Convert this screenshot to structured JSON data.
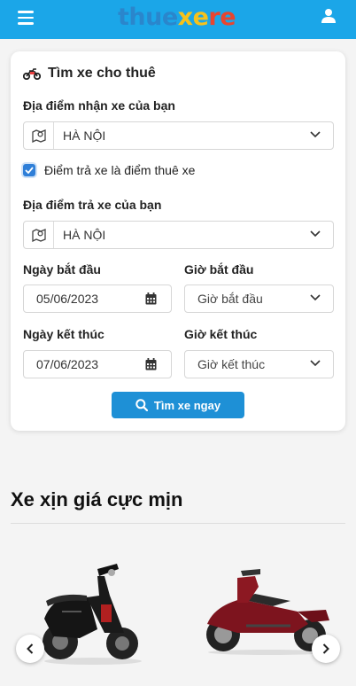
{
  "header": {
    "logo_part1": "thue",
    "logo_part2": "xe",
    "logo_part3": "re",
    "menu_icon": "hamburger-icon",
    "user_icon": "user-icon",
    "background": "#1ba6e8"
  },
  "search_form": {
    "title": "Tìm xe cho thuê",
    "pickup_label": "Địa điểm nhận xe của bạn",
    "pickup_value": "HÀ NỘI",
    "same_return_checked": true,
    "same_return_label": "Điểm trả xe là điểm thuê xe",
    "return_label": "Địa điểm trả xe của bạn",
    "return_value": "HÀ NỘI",
    "start_date_label": "Ngày bắt đầu",
    "start_date_value": "05/06/2023",
    "start_time_label": "Giờ bắt đầu",
    "start_time_value": "Giờ bắt đầu",
    "end_date_label": "Ngày kết thúc",
    "end_date_value": "07/06/2023",
    "end_time_label": "Giờ kết thúc",
    "end_time_value": "Giờ kết thúc",
    "submit_label": "Tìm xe ngay",
    "accent": "#1e90d6"
  },
  "featured": {
    "title": "Xe xịn giá cực mịn",
    "products": [
      {
        "name": "black-scooter",
        "color": "#1a1a1a"
      },
      {
        "name": "red-scooter",
        "color": "#8a1520"
      }
    ]
  }
}
